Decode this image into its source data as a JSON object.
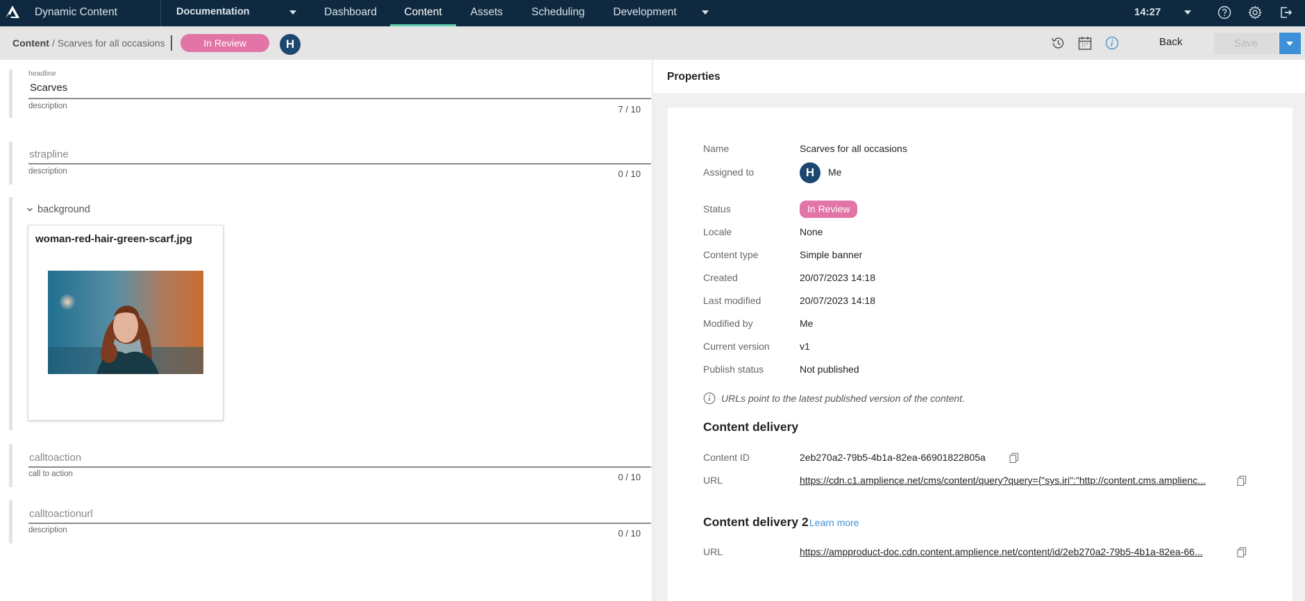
{
  "topnav": {
    "app_title": "Dynamic Content",
    "hub": "Documentation",
    "tabs": [
      {
        "label": "Dashboard",
        "active": false
      },
      {
        "label": "Content",
        "active": true
      },
      {
        "label": "Assets",
        "active": false
      },
      {
        "label": "Scheduling",
        "active": false
      },
      {
        "label": "Development",
        "active": false
      }
    ],
    "clock": "14:27",
    "icons": [
      "help-icon",
      "settings-icon",
      "logout-icon"
    ],
    "accent_color": "#5fd3b0"
  },
  "subbar": {
    "breadcrumb_root": "Content",
    "breadcrumb_current": "/ Scarves for all occasions",
    "status": "In Review",
    "avatar_initial": "H",
    "back_label": "Back",
    "save_label": "Save",
    "status_color": "#e274a6"
  },
  "editor": {
    "headline": {
      "label": "headline",
      "value": "Scarves",
      "description": "description",
      "count": "7 / 10"
    },
    "strapline": {
      "placeholder": "strapline",
      "description": "description",
      "count": "0 / 10"
    },
    "background": {
      "label": "background",
      "file_name": "woman-red-hair-green-scarf.jpg"
    },
    "calltoaction": {
      "placeholder": "calltoaction",
      "description": "call to action",
      "count": "0 / 10"
    },
    "calltoactionurl": {
      "placeholder": "calltoactionurl",
      "description": "description",
      "count": "0 / 10"
    }
  },
  "properties": {
    "title": "Properties",
    "rows": {
      "name": {
        "label": "Name",
        "value": "Scarves for all occasions"
      },
      "assigned": {
        "label": "Assigned to",
        "initial": "H",
        "value": "Me"
      },
      "status": {
        "label": "Status",
        "value": "In Review"
      },
      "locale": {
        "label": "Locale",
        "value": "None"
      },
      "content_type": {
        "label": "Content type",
        "value": "Simple banner"
      },
      "created": {
        "label": "Created",
        "value": "20/07/2023 14:18"
      },
      "last_modified": {
        "label": "Last modified",
        "value": "20/07/2023 14:18"
      },
      "modified_by": {
        "label": "Modified by",
        "value": "Me"
      },
      "current_version": {
        "label": "Current version",
        "value": "v1"
      },
      "publish_status": {
        "label": "Publish status",
        "value": "Not published"
      }
    },
    "info_note": "URLs point to the latest published version of the content.",
    "delivery": {
      "title": "Content delivery",
      "content_id_label": "Content ID",
      "content_id": "2eb270a2-79b5-4b1a-82ea-66901822805a",
      "url_label": "URL",
      "url": "https://cdn.c1.amplience.net/cms/content/query?query={\"sys.iri\":\"http://content.cms.amplienc..."
    },
    "delivery2": {
      "title": "Content delivery 2",
      "learn_more": "Learn more",
      "url_label": "URL",
      "url": "https://ampproduct-doc.cdn.content.amplience.net/content/id/2eb270a2-79b5-4b1a-82ea-66..."
    }
  }
}
